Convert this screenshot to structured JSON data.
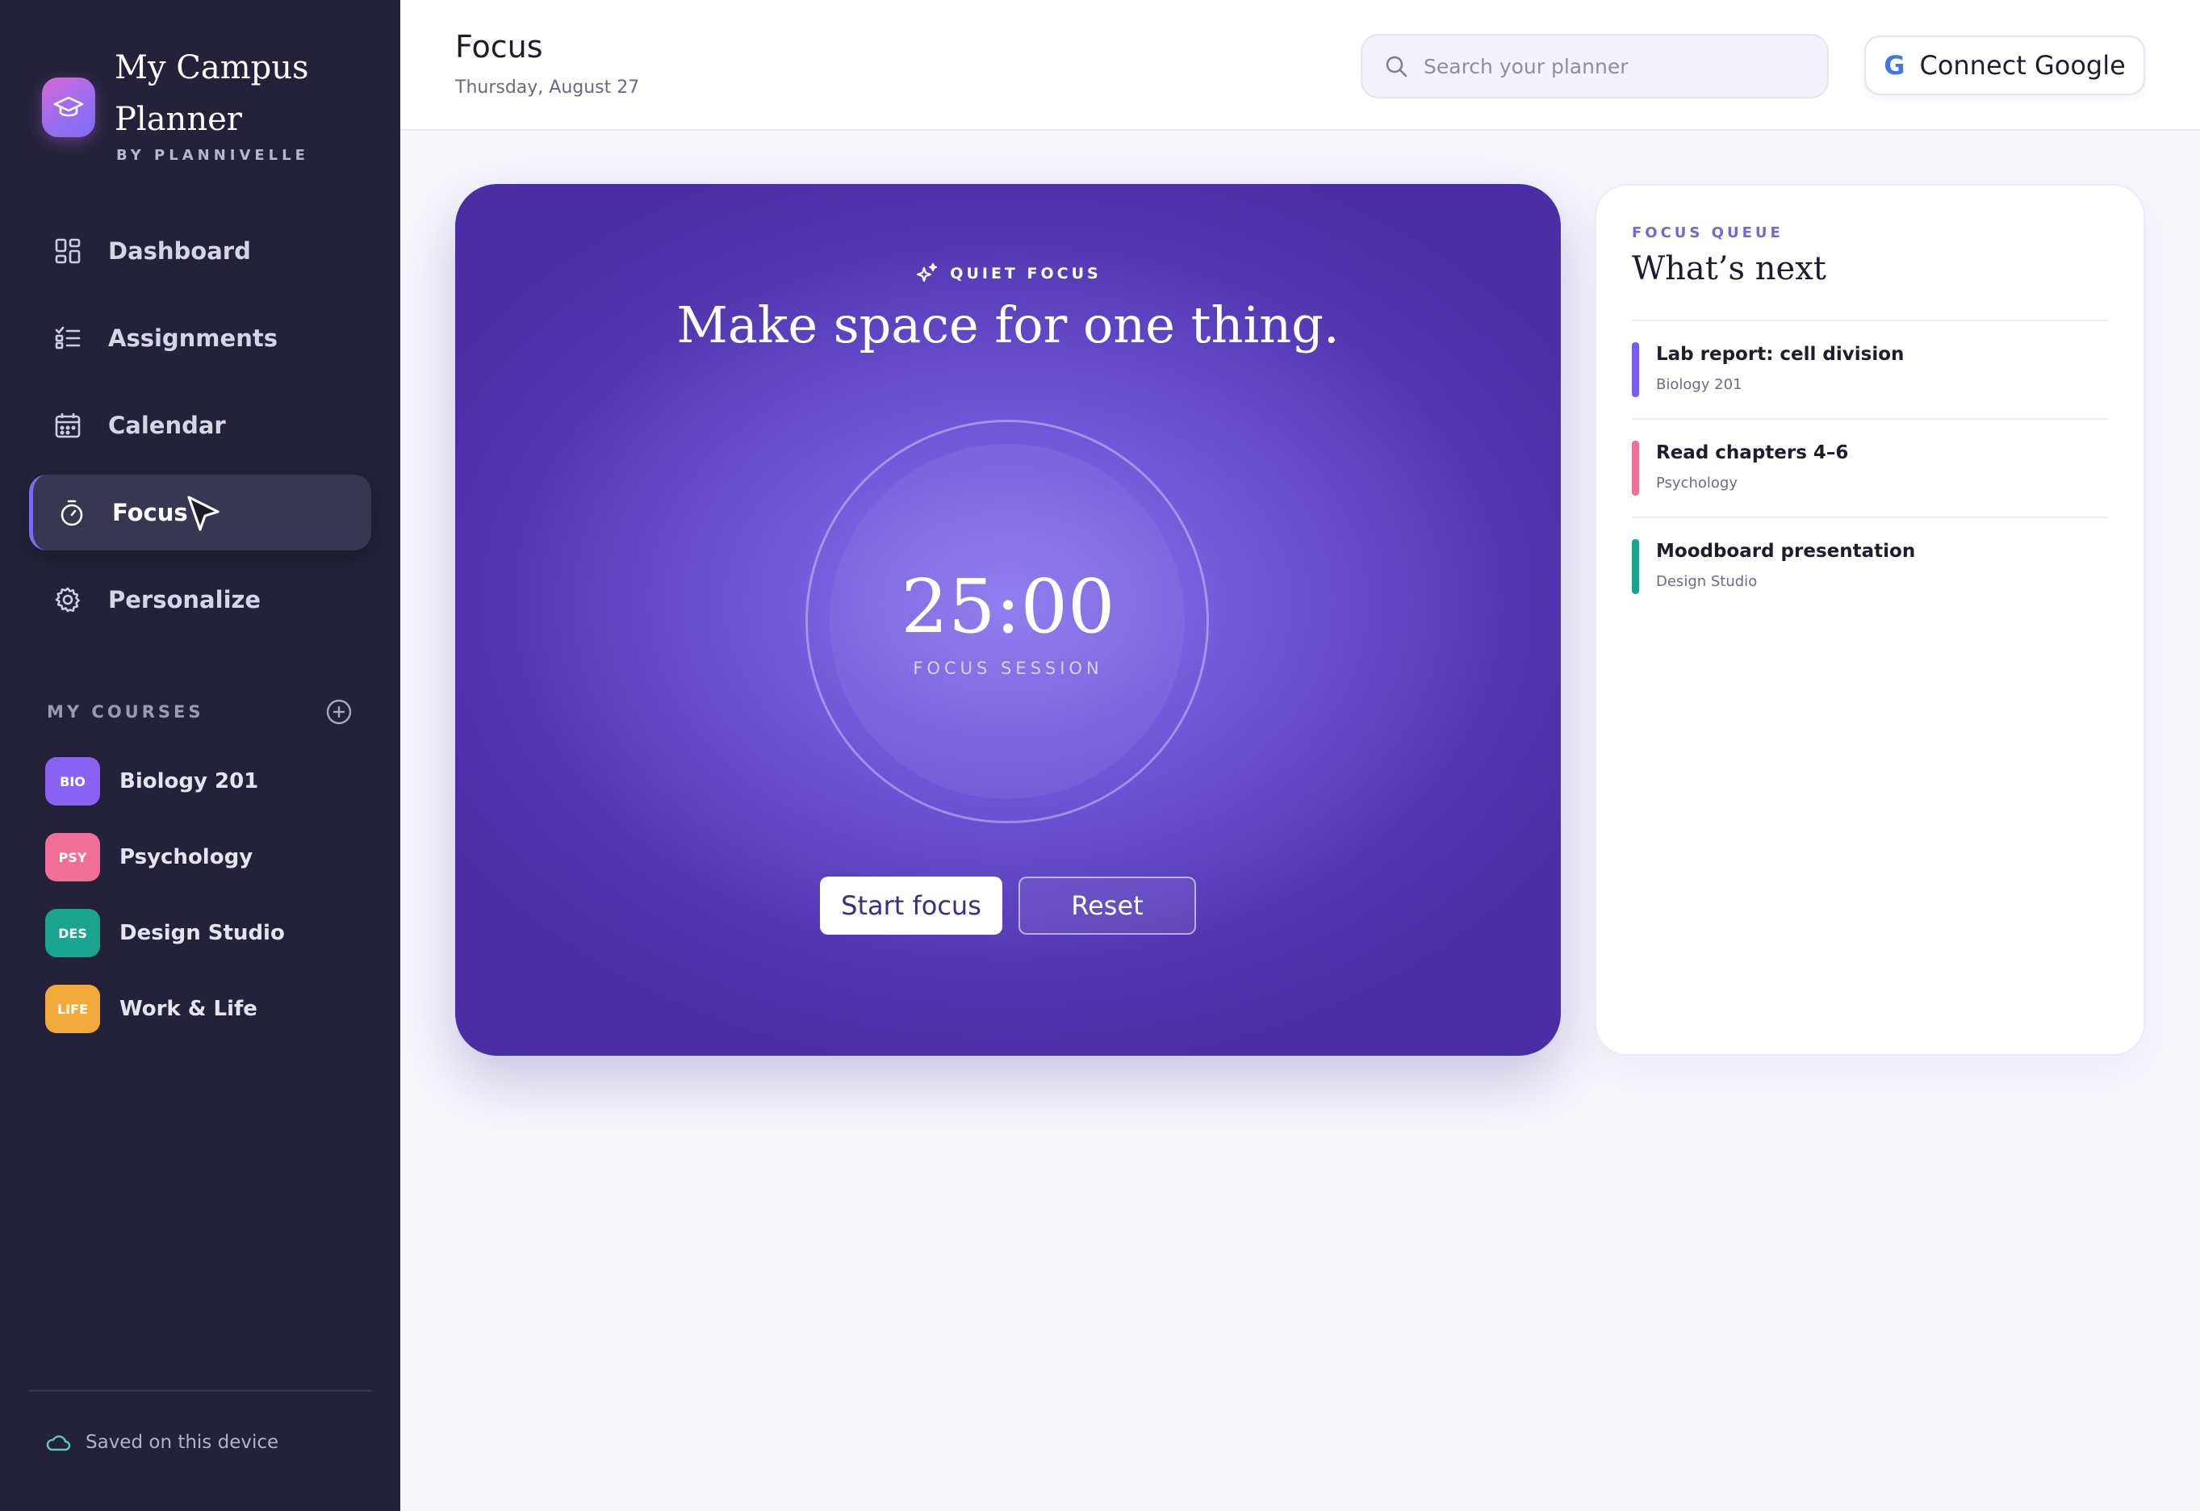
{
  "app": {
    "title": "My Campus Planner",
    "byline": "BY PLANNIVELLE"
  },
  "colors": {
    "sidebar_bg": "#23223a",
    "accent": "#7e6cf0",
    "focus_card": "#5f45c8",
    "page_bg": "#f7f6fb"
  },
  "nav": [
    {
      "label": "Dashboard",
      "icon": "grid-icon",
      "active": false
    },
    {
      "label": "Assignments",
      "icon": "checklist-icon",
      "active": false
    },
    {
      "label": "Calendar",
      "icon": "calendar-icon",
      "active": false
    },
    {
      "label": "Focus",
      "icon": "stopwatch-icon",
      "active": true
    },
    {
      "label": "Personalize",
      "icon": "gear-icon",
      "active": false
    }
  ],
  "courses": {
    "heading": "MY COURSES",
    "items": [
      {
        "code": "BIO",
        "name": "Biology 201",
        "color": "#8a63f2"
      },
      {
        "code": "PSY",
        "name": "Psychology",
        "color": "#f06f97"
      },
      {
        "code": "DES",
        "name": "Design Studio",
        "color": "#1aa38e"
      },
      {
        "code": "LIFE",
        "name": "Work & Life",
        "color": "#f0a93a"
      }
    ]
  },
  "footer": {
    "saved": "Saved on this device"
  },
  "header": {
    "title": "Focus",
    "date": "Thursday, August 27",
    "search_placeholder": "Search your planner",
    "connect_label": "Connect Google",
    "connect_icon_letter": "G"
  },
  "focus": {
    "kicker": "QUIET FOCUS",
    "headline": "Make space for one thing.",
    "timer": "25:00",
    "session_label": "FOCUS SESSION",
    "start_label": "Start focus",
    "reset_label": "Reset"
  },
  "queue": {
    "kicker": "FOCUS QUEUE",
    "title": "What’s next",
    "items": [
      {
        "title": "Lab report: cell division",
        "course": "Biology 201",
        "color": "#7b5cf0"
      },
      {
        "title": "Read chapters 4–6",
        "course": "Psychology",
        "color": "#f06f97"
      },
      {
        "title": "Moodboard presentation",
        "course": "Design Studio",
        "color": "#1aa38e"
      }
    ]
  }
}
